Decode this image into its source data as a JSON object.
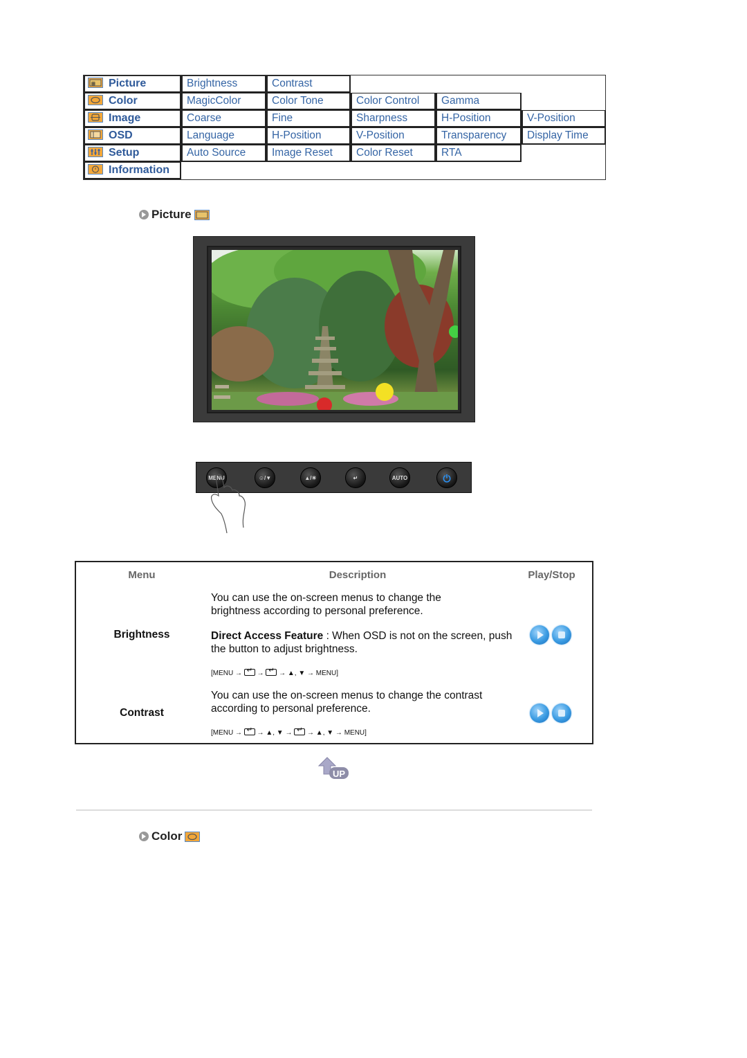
{
  "menu_map": {
    "rows": [
      {
        "main": "Picture",
        "icon": "picture-icon",
        "items": [
          "Brightness",
          "Contrast"
        ]
      },
      {
        "main": "Color",
        "icon": "color-icon",
        "items": [
          "MagicColor",
          "Color Tone",
          "Color Control",
          "Gamma"
        ]
      },
      {
        "main": "Image",
        "icon": "image-icon",
        "items": [
          "Coarse",
          "Fine",
          "Sharpness",
          "H-Position",
          "V-Position"
        ]
      },
      {
        "main": "OSD",
        "icon": "osd-icon",
        "items": [
          "Language",
          "H-Position",
          "V-Position",
          "Transparency",
          "Display Time"
        ]
      },
      {
        "main": "Setup",
        "icon": "setup-icon",
        "items": [
          "Auto Source",
          "Image Reset",
          "Color Reset",
          "RTA"
        ]
      },
      {
        "main": "Information",
        "icon": "information-icon",
        "items": []
      }
    ]
  },
  "sections": {
    "picture_title": "Picture",
    "color_title": "Color"
  },
  "button_panel": {
    "buttons": [
      {
        "label": "MENU",
        "icon": "menu-button-icon"
      },
      {
        "label": "☺/▼",
        "icon": "magicbright-down-icon"
      },
      {
        "label": "▲/☀",
        "icon": "up-brightness-icon"
      },
      {
        "label": "↵",
        "icon": "enter-icon"
      },
      {
        "label": "AUTO",
        "icon": "auto-icon"
      },
      {
        "label": "⏻",
        "icon": "power-icon"
      }
    ]
  },
  "desc_table": {
    "headers": {
      "menu": "Menu",
      "description": "Description",
      "playstop": "Play/Stop"
    },
    "rows": [
      {
        "menu": "Brightness",
        "description": "You can use the on-screen menus to change the brightness according to personal preference.",
        "direct_label": "Direct Access Feature",
        "direct_text": " : When OSD is not on the screen, push the button to adjust brightness.",
        "path": [
          "[MENU → ",
          "enter",
          " → ",
          "enter",
          " → ▲, ▼ → MENU]"
        ]
      },
      {
        "menu": "Contrast",
        "description": "You can use the on-screen menus to change the contrast according to personal preference.",
        "path": [
          "[MENU → ",
          "enter",
          " → ▲, ▼ → ",
          "enter",
          " → ▲, ▼ → MENU]"
        ]
      }
    ]
  },
  "up_link": {
    "label": "UP"
  }
}
